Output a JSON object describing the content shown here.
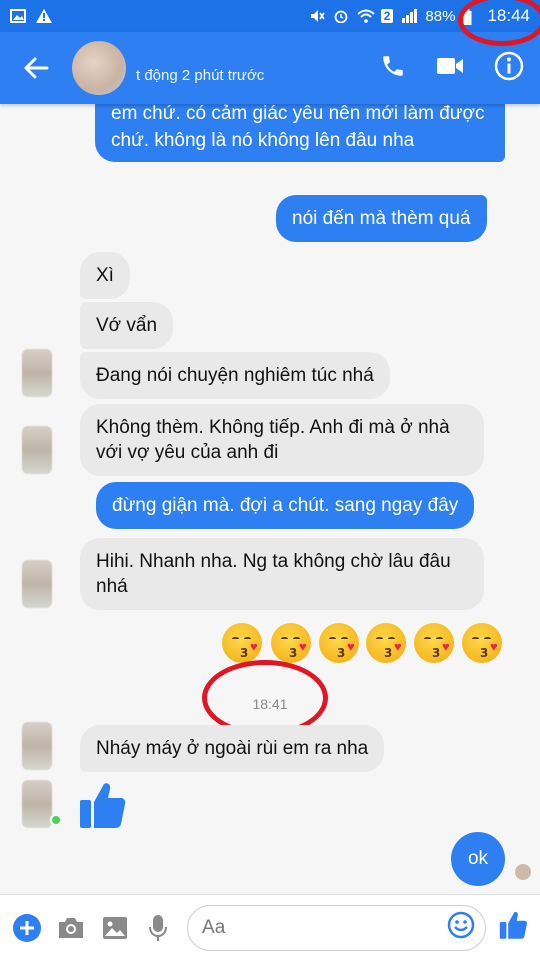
{
  "status_bar": {
    "battery": "88%",
    "time": "18:44",
    "sim_badge": "2"
  },
  "header": {
    "status": "t động 2 phút trước"
  },
  "messages": [
    {
      "dir": "out",
      "text": "em chứ. có cảm giác yêu nên mới làm được chứ. không là nó không lên đâu nha"
    },
    {
      "dir": "out",
      "text": "nói đến mà thèm quá"
    },
    {
      "dir": "in",
      "text": "Xì"
    },
    {
      "dir": "in",
      "text": "Vớ vẩn"
    },
    {
      "dir": "in",
      "text": "Đang nói chuyện nghiêm túc nhá"
    },
    {
      "dir": "in",
      "text": "Không thèm. Không tiếp. Anh đi mà ở nhà với vợ yêu của anh đi"
    },
    {
      "dir": "out",
      "text": "đừng giận mà. đợi a chút. sang ngay đây"
    },
    {
      "dir": "in",
      "text": "Hihi. Nhanh nha. Ng ta không chờ lâu đâu nhá"
    },
    {
      "dir": "in",
      "text": "Nháy máy ở ngoài rùi em ra nha"
    },
    {
      "dir": "out",
      "text": "ok"
    }
  ],
  "emoji_row": {
    "count": 6,
    "icon": "kissing-heart-emoji"
  },
  "timestamp": "18:41",
  "composer": {
    "placeholder": "Aa"
  },
  "colors": {
    "brand": "#2d7ff2",
    "status_bar": "#1d72e8",
    "highlight_ring": "#e01623"
  }
}
